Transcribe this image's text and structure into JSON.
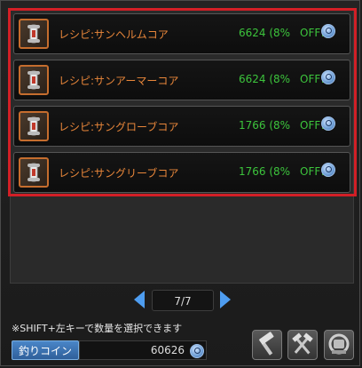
{
  "items": [
    {
      "name": "レシピ:サンヘルムコア",
      "price": "6624 (8%",
      "discount": "OFF!)"
    },
    {
      "name": "レシピ:サンアーマーコア",
      "price": "6624 (8%",
      "discount": "OFF!)"
    },
    {
      "name": "レシピ:サングローブコア",
      "price": "1766 (8%",
      "discount": "OFF!)"
    },
    {
      "name": "レシピ:サングリーブコア",
      "price": "1766 (8%",
      "discount": "OFF!)"
    }
  ],
  "pager": {
    "label": "7/7"
  },
  "hint": "※SHIFT+左キーで数量を選択できます",
  "currency": {
    "label": "釣りコイン",
    "value": "60626"
  },
  "colors": {
    "highlight": "#d21f26",
    "name": "#e8863a",
    "price": "#3cc43c",
    "accent": "#4e9df0"
  },
  "icons": {
    "item": "recipe-scroll-icon",
    "detail": "magnifier-icon",
    "tools": [
      "hammer-icon",
      "crossed-hammers-icon",
      "anvil-icon"
    ]
  }
}
